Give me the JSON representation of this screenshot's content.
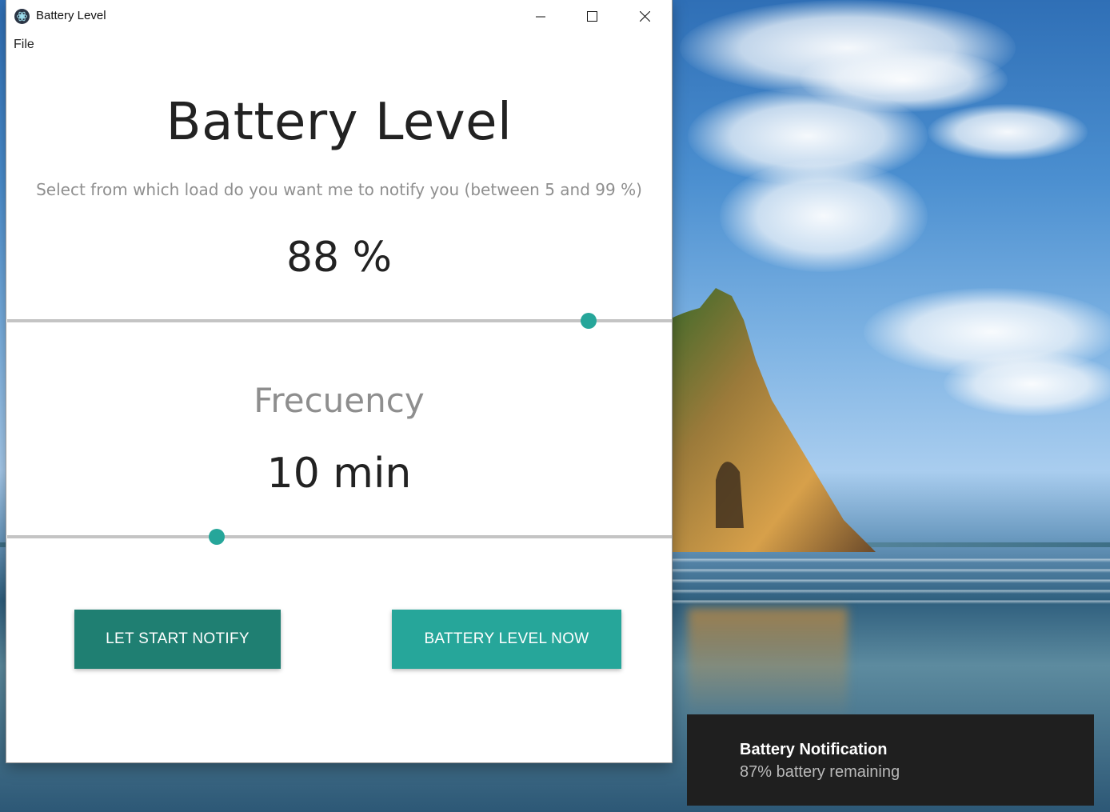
{
  "window": {
    "title": "Battery Level",
    "menu": [
      "File"
    ]
  },
  "main": {
    "heading": "Battery Level",
    "subtitle": "Select from which load do you want me to notify you (between 5 and 99 %)",
    "battery_threshold": {
      "display": "88 %",
      "value": 88,
      "min": 5,
      "max": 99
    },
    "frequency": {
      "title": "Frecuency",
      "display": "10 min",
      "value": 10
    }
  },
  "buttons": {
    "start_notify": "LET START NOTIFY",
    "level_now": "BATTERY LEVEL NOW"
  },
  "notification": {
    "title": "Battery Notification",
    "body": "87% battery remaining"
  },
  "colors": {
    "accent": "#26a69a",
    "accent_dark": "#1f7f72",
    "toast_bg": "#1f1f1f"
  },
  "icons": [
    "app-icon",
    "minimize-icon",
    "maximize-icon",
    "close-icon"
  ]
}
